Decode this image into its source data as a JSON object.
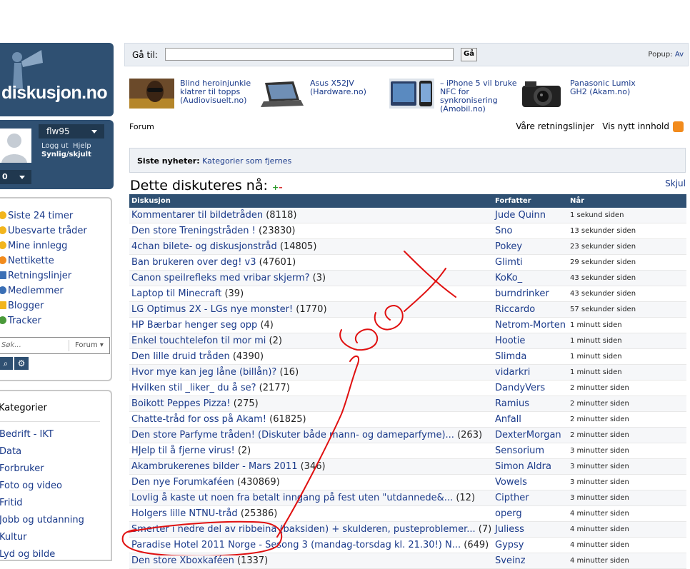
{
  "site": {
    "logo_text": "diskusjon.no"
  },
  "user": {
    "name": "flw95",
    "logout": "Logg ut",
    "help": "Hjelp",
    "visibility": "Synlig/skjult",
    "counter": "0"
  },
  "nav": {
    "items": [
      {
        "label": "Siste 24 timer",
        "icon_color": "#f2b51d"
      },
      {
        "label": "Ubesvarte tråder",
        "icon_color": "#f2b51d"
      },
      {
        "label": "Mine innlegg",
        "icon_color": "#f2b51d"
      },
      {
        "label": "Nettikette",
        "icon_color": "#f28b1d"
      },
      {
        "label": "Retningslinjer",
        "icon_color": "#3b6fb5"
      },
      {
        "label": "Medlemmer",
        "icon_color": "#3b6fb5"
      },
      {
        "label": "Blogger",
        "icon_color": "#f2b51d"
      },
      {
        "label": "Tracker",
        "icon_color": "#4a9a3a"
      }
    ],
    "search_placeholder": "Søk...",
    "search_scope": "Forum"
  },
  "categories": {
    "title": "Kategorier",
    "items": [
      "Bedrift - IKT",
      "Data",
      "Forbruker",
      "Foto og video",
      "Fritid",
      "Jobb og utdanning",
      "Kultur",
      "Lyd og bilde"
    ]
  },
  "goto": {
    "label": "Gå til:",
    "button": "Gå",
    "popup_label": "Popup:",
    "popup_value": "Av"
  },
  "news": [
    {
      "caption": "Blind heroinjunkie klatrer til topps (Audiovisuelt.no)"
    },
    {
      "caption": "Asus X52JV (Hardware.no)"
    },
    {
      "caption": "– iPhone 5 vil bruke NFC for synkronisering (Amobil.no)"
    },
    {
      "caption": "Panasonic Lumix GH2 (Akam.no)"
    }
  ],
  "forumbar": {
    "forum": "Forum",
    "guidelines": "Våre retningslinjer",
    "new_content": "Vis nytt innhold"
  },
  "siste": {
    "label": "Siste nyheter:",
    "link": "Kategorier som fjernes"
  },
  "discussion": {
    "title": "Dette diskuteres nå:",
    "plus": "+",
    "minus": "–",
    "hide": "Skjul",
    "headers": {
      "topic": "Diskusjon",
      "author": "Forfatter",
      "when": "Når"
    },
    "rows": [
      {
        "topic": "Kommentarer til bildetråden",
        "count": "(8118)",
        "author": "Jude Quinn",
        "when": "1 sekund siden"
      },
      {
        "topic": "Den store Treningstråden !",
        "count": "(23830)",
        "author": "Sno",
        "when": "13 sekunder siden"
      },
      {
        "topic": "4chan bilete- og diskusjonstråd",
        "count": "(14805)",
        "author": "Pokey",
        "when": "23 sekunder siden"
      },
      {
        "topic": "Ban brukeren over deg! v3",
        "count": "(47601)",
        "author": "Glimti",
        "when": "29 sekunder siden"
      },
      {
        "topic": "Canon speilrefleks med vribar skjerm?",
        "count": "(3)",
        "author": "KoKo_",
        "when": "43 sekunder siden"
      },
      {
        "topic": "Laptop til Minecraft",
        "count": "(39)",
        "author": "burndrinker",
        "when": "43 sekunder siden"
      },
      {
        "topic": "LG Optimus 2X - LGs nye monster!",
        "count": "(1770)",
        "author": "Riccardo",
        "when": "57 sekunder siden"
      },
      {
        "topic": "HP Bærbar henger seg opp",
        "count": "(4)",
        "author": "Netrom-Morten",
        "when": "1 minutt siden"
      },
      {
        "topic": "Enkel touchtelefon til mor mi",
        "count": "(2)",
        "author": "Hootie",
        "when": "1 minutt siden"
      },
      {
        "topic": "Den lille druid tråden",
        "count": "(4390)",
        "author": "Slimda",
        "when": "1 minutt siden"
      },
      {
        "topic": "Hvor mye kan jeg låne (billån)?",
        "count": "(16)",
        "author": "vidarkri",
        "when": "1 minutt siden"
      },
      {
        "topic": "Hvilken stil _liker_ du å se?",
        "count": "(2177)",
        "author": "DandyVers",
        "when": "2 minutter siden"
      },
      {
        "topic": "Boikott Peppes Pizza!",
        "count": "(275)",
        "author": "Ramius",
        "when": "2 minutter siden"
      },
      {
        "topic": "Chatte-tråd for oss på Akam!",
        "count": "(61825)",
        "author": "Anfall",
        "when": "2 minutter siden"
      },
      {
        "topic": "Den store Parfyme tråden! (Diskuter både mann- og dameparfyme)...",
        "count": "(263)",
        "author": "DexterMorgan",
        "when": "2 minutter siden"
      },
      {
        "topic": "HJelp til å fjerne virus!",
        "count": "(2)",
        "author": "Sensorium",
        "when": "3 minutter siden"
      },
      {
        "topic": "Akambrukerenes bilder - Mars 2011",
        "count": "(346)",
        "author": "Simon Aldra",
        "when": "3 minutter siden"
      },
      {
        "topic": "Den nye Forumkaféen",
        "count": "(430869)",
        "author": "Vowels",
        "when": "3 minutter siden"
      },
      {
        "topic": "Lovlig å kaste ut noen fra betalt inngang på fest uten \"utdannede&...",
        "count": "(12)",
        "author": "Cipther",
        "when": "3 minutter siden"
      },
      {
        "topic": "Holgers lille NTNU-tråd",
        "count": "(25386)",
        "author": "operg",
        "when": "4 minutter siden"
      },
      {
        "topic": "Smerter i nedre del av ribbeina (baksiden) + skulderen, pusteproblemer...",
        "count": "(7)",
        "author": "Juliess",
        "when": "4 minutter siden"
      },
      {
        "topic": "Paradise Hotel 2011 Norge - Sesong 3 (mandag-torsdag kl. 21.30!) N...",
        "count": "(649)",
        "author": "Gypsy",
        "when": "4 minutter siden"
      },
      {
        "topic": "Den store Xboxkaféen",
        "count": "(1337)",
        "author": "Sveinz",
        "when": "4 minutter siden"
      }
    ]
  },
  "annotation": {
    "text": "Leet",
    "color": "#e01010"
  }
}
